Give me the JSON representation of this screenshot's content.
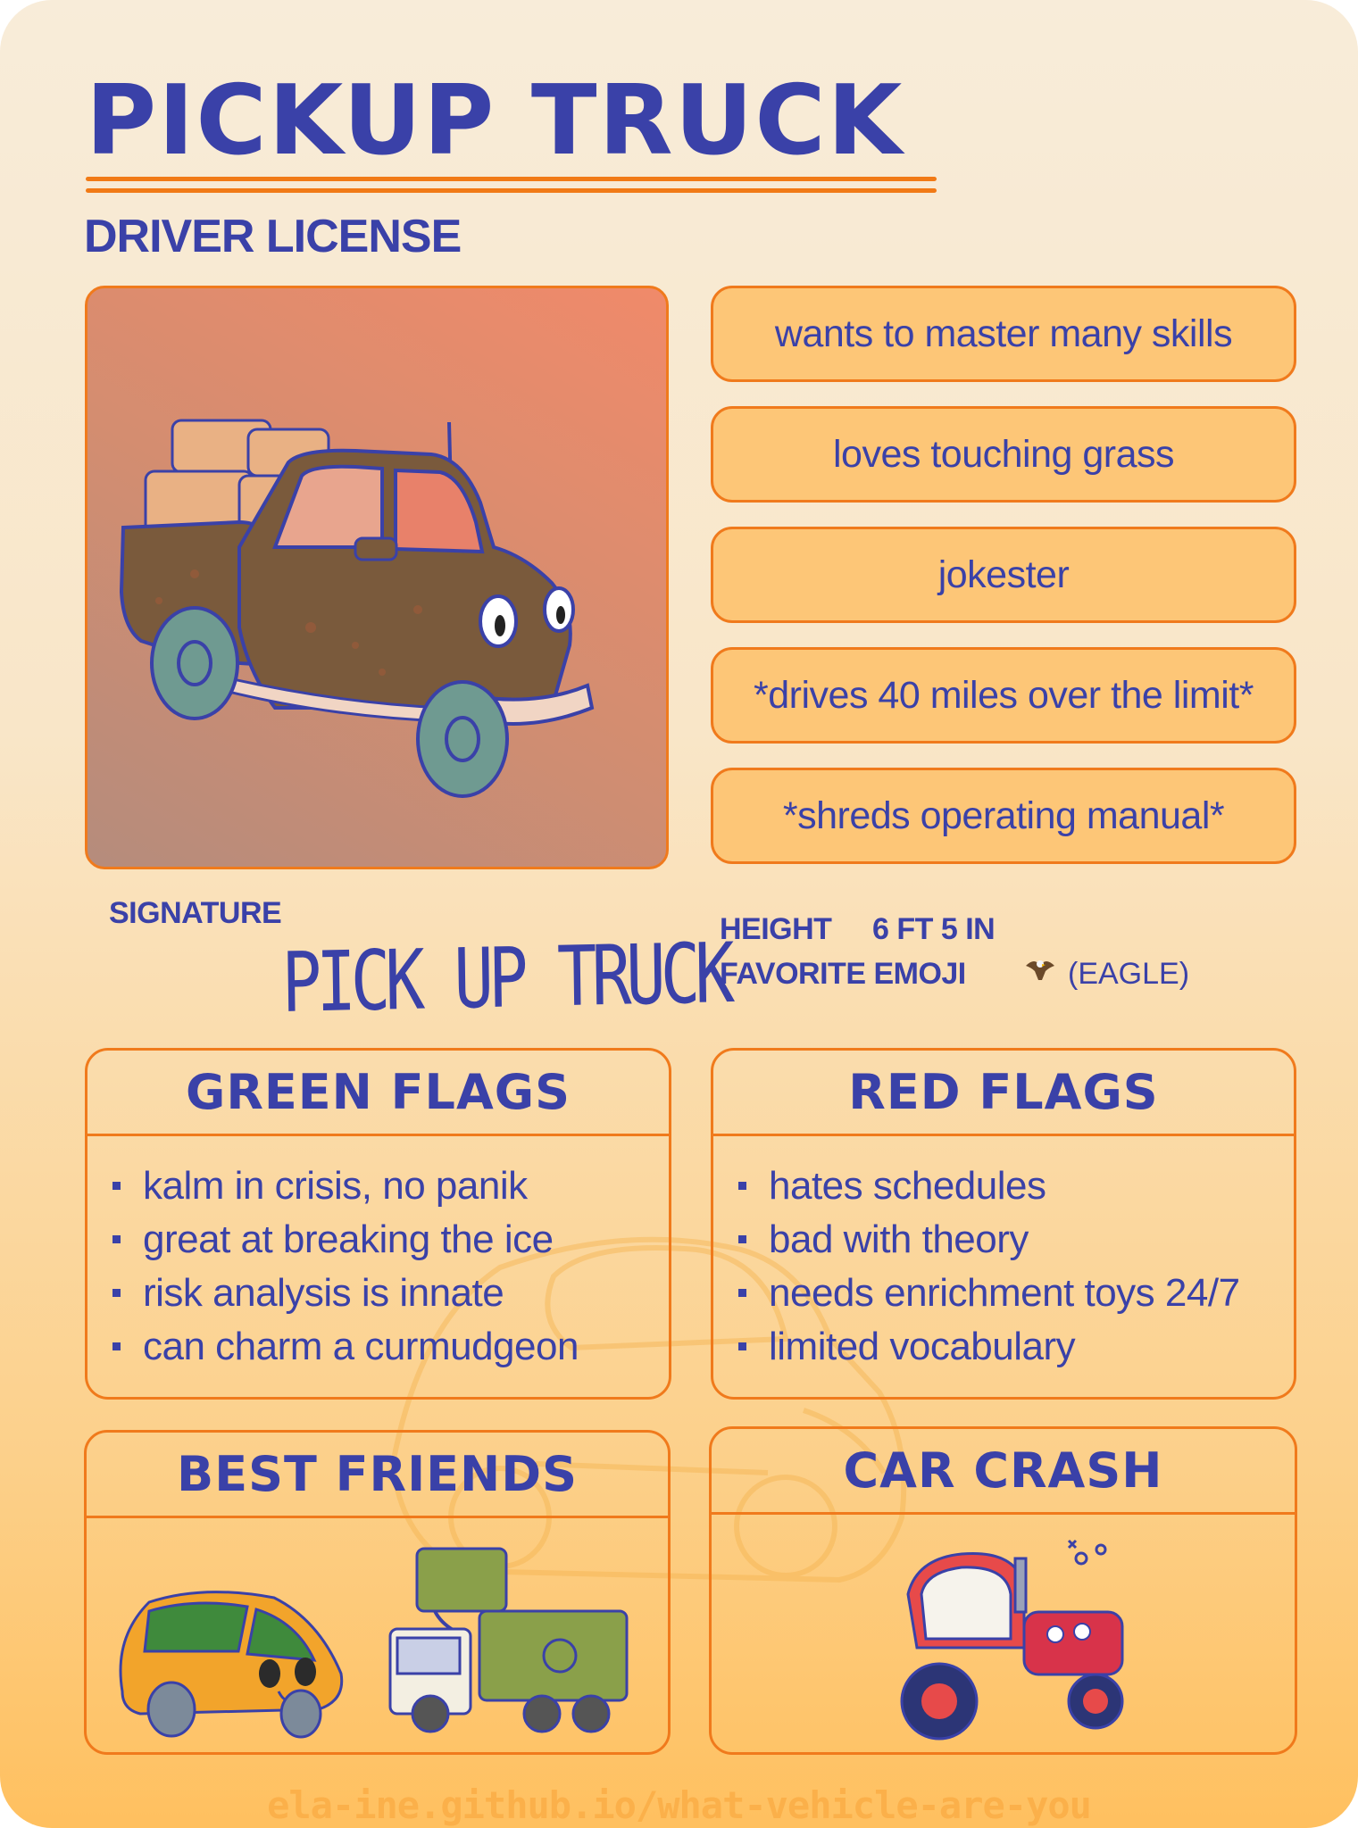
{
  "header": {
    "title": "PICKUP TRUCK",
    "subtitle": "DRIVER LICENSE"
  },
  "photo": {
    "icon": "pickup-truck-illustration"
  },
  "traits": [
    "wants to master many skills",
    "loves touching grass",
    "jokester",
    "*drives 40 miles over the limit*",
    "*shreds operating manual*"
  ],
  "signature": {
    "label": "SIGNATURE",
    "text": "PICK UP TRUCK"
  },
  "stats": {
    "height_label": "HEIGHT",
    "height_value": "6 FT 5 IN",
    "emoji_label": "FAVORITE EMOJI",
    "emoji_icon": "eagle-emoji",
    "emoji_value": "(EAGLE)"
  },
  "green_flags": {
    "title": "GREEN FLAGS",
    "items": [
      "kalm in crisis, no panik",
      "great at breaking the ice",
      "risk analysis is innate",
      "can charm a curmudgeon"
    ]
  },
  "red_flags": {
    "title": "RED FLAGS",
    "items": [
      "hates schedules",
      "bad with theory",
      "needs enrichment toys 24/7",
      "limited vocabulary"
    ]
  },
  "best_friends": {
    "title": "BEST FRIENDS",
    "icons": [
      "minivan-illustration",
      "garbage-truck-illustration"
    ]
  },
  "car_crash": {
    "title": "CAR CRASH",
    "icon": "tractor-illustration"
  },
  "footer": {
    "url": "ela-ine.github.io/what-vehicle-are-you"
  },
  "colors": {
    "accent_blue": "#3a41a8",
    "accent_orange": "#f07a1c",
    "trait_fill": "#fdc677"
  }
}
